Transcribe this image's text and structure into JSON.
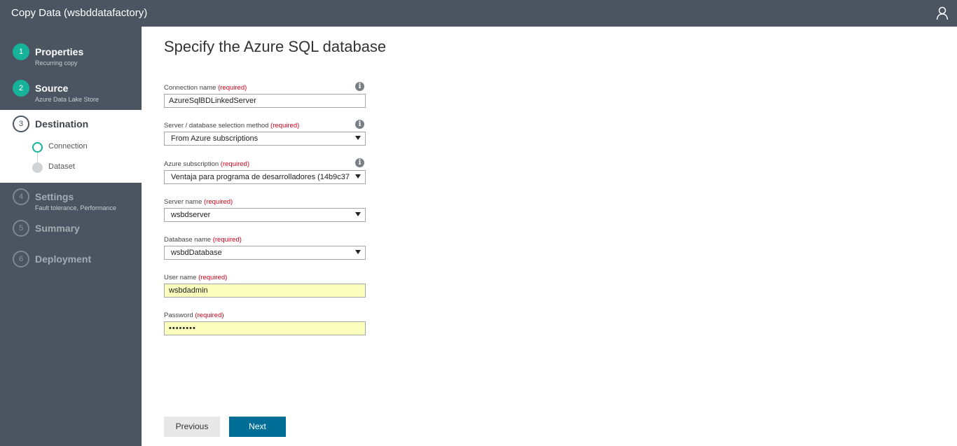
{
  "window": {
    "title": "Copy Data (wsbddatafactory)",
    "user_icon": "person-icon"
  },
  "sidebar": {
    "steps": [
      {
        "num": "1",
        "label": "Properties",
        "sub": "Recurring copy",
        "state": "done"
      },
      {
        "num": "2",
        "label": "Source",
        "sub": "Azure Data Lake Store",
        "state": "done"
      },
      {
        "num": "3",
        "label": "Destination",
        "sub": "",
        "state": "active",
        "substeps": [
          {
            "label": "Connection",
            "state": "current"
          },
          {
            "label": "Dataset",
            "state": "pending"
          }
        ]
      },
      {
        "num": "4",
        "label": "Settings",
        "sub": "Fault tolerance, Performance",
        "state": "todo"
      },
      {
        "num": "5",
        "label": "Summary",
        "sub": "",
        "state": "todo"
      },
      {
        "num": "6",
        "label": "Deployment",
        "sub": "",
        "state": "todo"
      }
    ]
  },
  "form": {
    "heading": "Specify the Azure SQL database",
    "required_text": "(required)",
    "info_glyph": "i",
    "fields": [
      {
        "label": "Connection name",
        "value": "AzureSqlBDLinkedServer",
        "type": "text",
        "info": true
      },
      {
        "label": "Server / database selection method",
        "value": "From Azure subscriptions",
        "type": "select",
        "info": true
      },
      {
        "label": "Azure subscription",
        "value": "Ventaja para programa de desarrolladores (14b9c37",
        "type": "select",
        "info": true
      },
      {
        "label": "Server name",
        "value": "wsbdserver",
        "type": "select",
        "info": false
      },
      {
        "label": "Database name",
        "value": "wsbdDatabase",
        "type": "select",
        "info": false
      },
      {
        "label": "User name",
        "value": "wsbdadmin",
        "type": "text",
        "info": false,
        "autofill": true
      },
      {
        "label": "Password",
        "value": "••••••••",
        "type": "password",
        "info": false,
        "autofill": true
      }
    ]
  },
  "buttons": {
    "previous": "Previous",
    "next": "Next"
  },
  "colors": {
    "sidebar": "#4a5561",
    "done_step": "#16b29a",
    "primary_button": "#006e96",
    "required": "#d0021b",
    "autofill": "#faffbd"
  }
}
